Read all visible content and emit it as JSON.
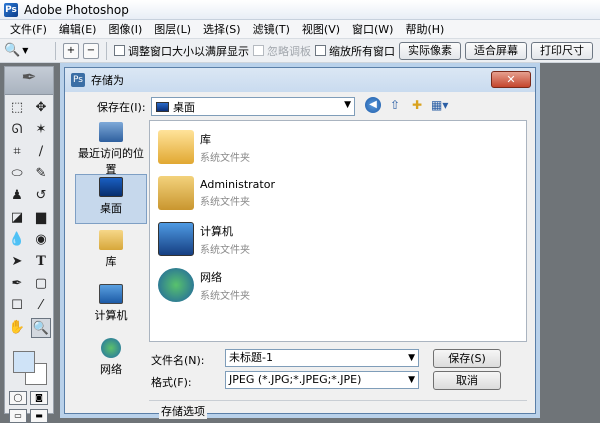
{
  "app": {
    "title": "Adobe Photoshop",
    "icon": "photoshop-icon"
  },
  "menu": [
    "文件(F)",
    "编辑(E)",
    "图像(I)",
    "图层(L)",
    "选择(S)",
    "滤镜(T)",
    "视图(V)",
    "窗口(W)",
    "帮助(H)"
  ],
  "options_bar": {
    "zoom_tool_icon": "zoom-tool-icon",
    "checks": [
      {
        "label": "调整窗口大小以满屏显示",
        "enabled": true
      },
      {
        "label": "忽略调板",
        "enabled": false
      },
      {
        "label": "缩放所有窗口",
        "enabled": true
      }
    ],
    "buttons": [
      "实际像素",
      "适合屏幕",
      "打印尺寸"
    ]
  },
  "toolbox": {
    "tools": [
      "rect-marquee-icon",
      "move-icon",
      "lasso-icon",
      "magic-wand-icon",
      "crop-icon",
      "slice-icon",
      "healing-brush-icon",
      "brush-icon",
      "clone-stamp-icon",
      "history-brush-icon",
      "eraser-icon",
      "gradient-icon",
      "blur-icon",
      "dodge-icon",
      "path-select-icon",
      "type-icon",
      "pen-icon",
      "shape-icon",
      "notes-icon",
      "eyedropper-icon",
      "hand-icon",
      "zoom-icon"
    ],
    "foreground_color": "#cfe3f7",
    "background_color": "#ffffff"
  },
  "dialog": {
    "title": "存储为",
    "close_label": "✕",
    "save_in_label": "保存在(I):",
    "save_in_value": "桌面",
    "places": [
      {
        "label": "最近访问的位置",
        "icon": "recent-places-icon",
        "active": false
      },
      {
        "label": "桌面",
        "icon": "desktop-icon",
        "active": true
      },
      {
        "label": "库",
        "icon": "library-icon",
        "active": false
      },
      {
        "label": "计算机",
        "icon": "computer-icon",
        "active": false
      },
      {
        "label": "网络",
        "icon": "network-icon",
        "active": false
      }
    ],
    "files": [
      {
        "name": "库",
        "type": "系统文件夹",
        "icon": "library-folder-icon"
      },
      {
        "name": "Administrator",
        "type": "系统文件夹",
        "icon": "user-folder-icon"
      },
      {
        "name": "计算机",
        "type": "系统文件夹",
        "icon": "computer-icon"
      },
      {
        "name": "网络",
        "type": "系统文件夹",
        "icon": "network-icon"
      }
    ],
    "filename_label": "文件名(N):",
    "filename_value": "未标题-1",
    "format_label": "格式(F):",
    "format_value": "JPEG (*.JPG;*.JPEG;*.JPE)",
    "save_button": "保存(S)",
    "cancel_button": "取消",
    "save_options_label": "存储选项"
  }
}
